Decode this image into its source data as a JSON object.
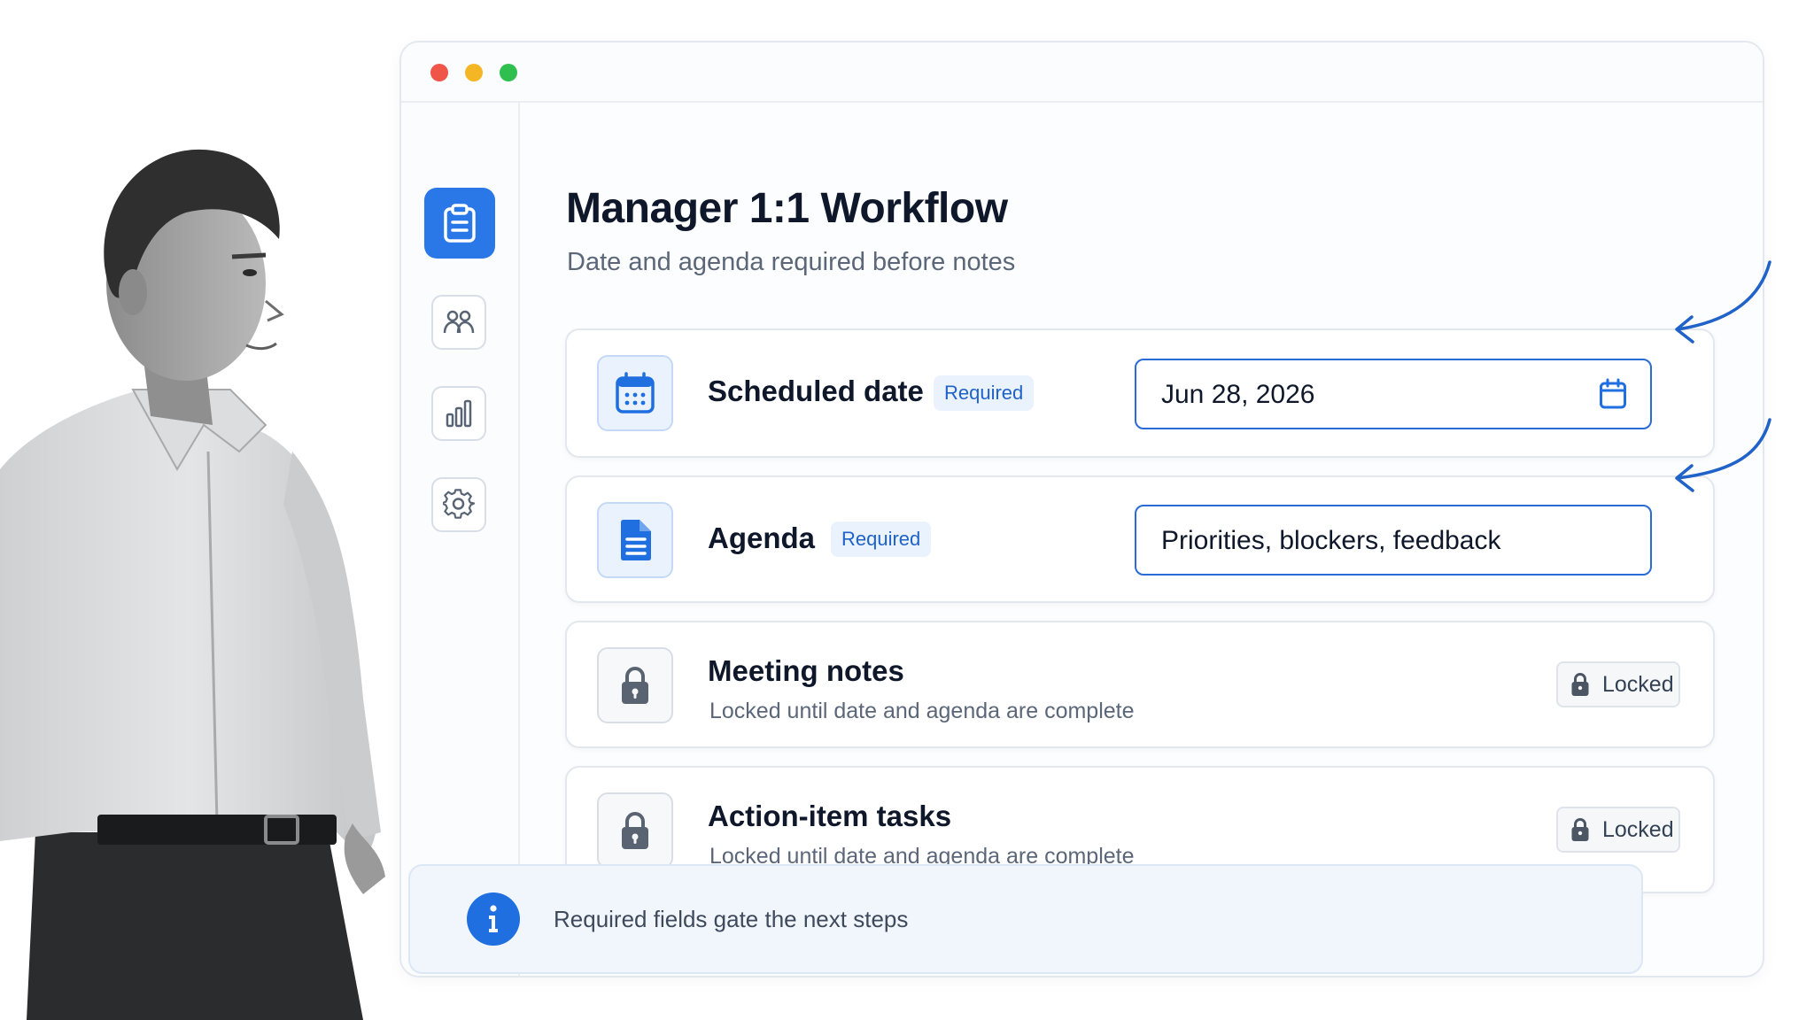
{
  "window": {
    "controls": [
      "close",
      "minimize",
      "maximize"
    ]
  },
  "sidebar": {
    "items": [
      {
        "icon": "clipboard-icon",
        "active": true
      },
      {
        "icon": "users-icon",
        "active": false
      },
      {
        "icon": "bar-chart-icon",
        "active": false
      },
      {
        "icon": "gear-icon",
        "active": false
      }
    ]
  },
  "page": {
    "title": "Manager 1:1 Workflow",
    "subtitle": "Date and agenda required before notes"
  },
  "steps": {
    "scheduled_date": {
      "label": "Scheduled date",
      "badge": "Required",
      "value": "Jun 28, 2026",
      "icon": "calendar-icon"
    },
    "agenda": {
      "label": "Agenda",
      "badge": "Required",
      "value": "Priorities, blockers, feedback",
      "icon": "document-icon"
    },
    "meeting_notes": {
      "label": "Meeting notes",
      "description": "Locked until date and agenda are complete",
      "status": "Locked",
      "icon": "lock-icon"
    },
    "action_items": {
      "label": "Action-item tasks",
      "description": "Locked until date and agenda are complete",
      "status": "Locked",
      "icon": "lock-icon"
    }
  },
  "info": {
    "text": "Required fields gate the next steps",
    "icon": "info-icon"
  },
  "colors": {
    "accent": "#2a78e8",
    "field_border": "#2a6bd5",
    "badge_bg": "#eaf2fd",
    "badge_text": "#1f62c8"
  }
}
